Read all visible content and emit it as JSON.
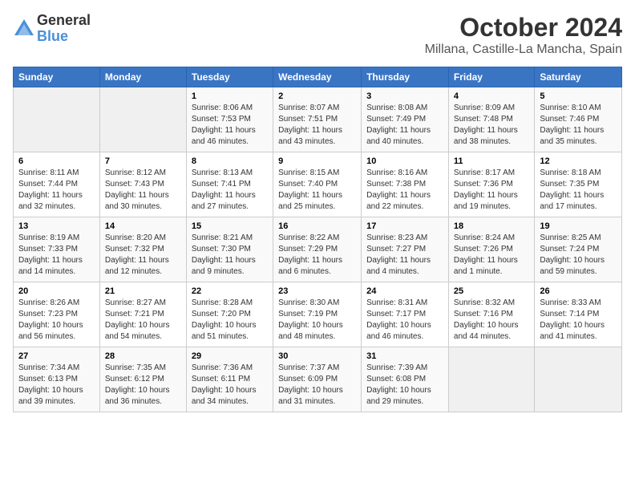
{
  "logo": {
    "general": "General",
    "blue": "Blue"
  },
  "header": {
    "month": "October 2024",
    "location": "Millana, Castille-La Mancha, Spain"
  },
  "weekdays": [
    "Sunday",
    "Monday",
    "Tuesday",
    "Wednesday",
    "Thursday",
    "Friday",
    "Saturday"
  ],
  "weeks": [
    [
      {
        "day": "",
        "empty": true
      },
      {
        "day": "",
        "empty": true
      },
      {
        "day": "1",
        "sunrise": "Sunrise: 8:06 AM",
        "sunset": "Sunset: 7:53 PM",
        "daylight": "Daylight: 11 hours and 46 minutes."
      },
      {
        "day": "2",
        "sunrise": "Sunrise: 8:07 AM",
        "sunset": "Sunset: 7:51 PM",
        "daylight": "Daylight: 11 hours and 43 minutes."
      },
      {
        "day": "3",
        "sunrise": "Sunrise: 8:08 AM",
        "sunset": "Sunset: 7:49 PM",
        "daylight": "Daylight: 11 hours and 40 minutes."
      },
      {
        "day": "4",
        "sunrise": "Sunrise: 8:09 AM",
        "sunset": "Sunset: 7:48 PM",
        "daylight": "Daylight: 11 hours and 38 minutes."
      },
      {
        "day": "5",
        "sunrise": "Sunrise: 8:10 AM",
        "sunset": "Sunset: 7:46 PM",
        "daylight": "Daylight: 11 hours and 35 minutes."
      }
    ],
    [
      {
        "day": "6",
        "sunrise": "Sunrise: 8:11 AM",
        "sunset": "Sunset: 7:44 PM",
        "daylight": "Daylight: 11 hours and 32 minutes."
      },
      {
        "day": "7",
        "sunrise": "Sunrise: 8:12 AM",
        "sunset": "Sunset: 7:43 PM",
        "daylight": "Daylight: 11 hours and 30 minutes."
      },
      {
        "day": "8",
        "sunrise": "Sunrise: 8:13 AM",
        "sunset": "Sunset: 7:41 PM",
        "daylight": "Daylight: 11 hours and 27 minutes."
      },
      {
        "day": "9",
        "sunrise": "Sunrise: 8:15 AM",
        "sunset": "Sunset: 7:40 PM",
        "daylight": "Daylight: 11 hours and 25 minutes."
      },
      {
        "day": "10",
        "sunrise": "Sunrise: 8:16 AM",
        "sunset": "Sunset: 7:38 PM",
        "daylight": "Daylight: 11 hours and 22 minutes."
      },
      {
        "day": "11",
        "sunrise": "Sunrise: 8:17 AM",
        "sunset": "Sunset: 7:36 PM",
        "daylight": "Daylight: 11 hours and 19 minutes."
      },
      {
        "day": "12",
        "sunrise": "Sunrise: 8:18 AM",
        "sunset": "Sunset: 7:35 PM",
        "daylight": "Daylight: 11 hours and 17 minutes."
      }
    ],
    [
      {
        "day": "13",
        "sunrise": "Sunrise: 8:19 AM",
        "sunset": "Sunset: 7:33 PM",
        "daylight": "Daylight: 11 hours and 14 minutes."
      },
      {
        "day": "14",
        "sunrise": "Sunrise: 8:20 AM",
        "sunset": "Sunset: 7:32 PM",
        "daylight": "Daylight: 11 hours and 12 minutes."
      },
      {
        "day": "15",
        "sunrise": "Sunrise: 8:21 AM",
        "sunset": "Sunset: 7:30 PM",
        "daylight": "Daylight: 11 hours and 9 minutes."
      },
      {
        "day": "16",
        "sunrise": "Sunrise: 8:22 AM",
        "sunset": "Sunset: 7:29 PM",
        "daylight": "Daylight: 11 hours and 6 minutes."
      },
      {
        "day": "17",
        "sunrise": "Sunrise: 8:23 AM",
        "sunset": "Sunset: 7:27 PM",
        "daylight": "Daylight: 11 hours and 4 minutes."
      },
      {
        "day": "18",
        "sunrise": "Sunrise: 8:24 AM",
        "sunset": "Sunset: 7:26 PM",
        "daylight": "Daylight: 11 hours and 1 minute."
      },
      {
        "day": "19",
        "sunrise": "Sunrise: 8:25 AM",
        "sunset": "Sunset: 7:24 PM",
        "daylight": "Daylight: 10 hours and 59 minutes."
      }
    ],
    [
      {
        "day": "20",
        "sunrise": "Sunrise: 8:26 AM",
        "sunset": "Sunset: 7:23 PM",
        "daylight": "Daylight: 10 hours and 56 minutes."
      },
      {
        "day": "21",
        "sunrise": "Sunrise: 8:27 AM",
        "sunset": "Sunset: 7:21 PM",
        "daylight": "Daylight: 10 hours and 54 minutes."
      },
      {
        "day": "22",
        "sunrise": "Sunrise: 8:28 AM",
        "sunset": "Sunset: 7:20 PM",
        "daylight": "Daylight: 10 hours and 51 minutes."
      },
      {
        "day": "23",
        "sunrise": "Sunrise: 8:30 AM",
        "sunset": "Sunset: 7:19 PM",
        "daylight": "Daylight: 10 hours and 48 minutes."
      },
      {
        "day": "24",
        "sunrise": "Sunrise: 8:31 AM",
        "sunset": "Sunset: 7:17 PM",
        "daylight": "Daylight: 10 hours and 46 minutes."
      },
      {
        "day": "25",
        "sunrise": "Sunrise: 8:32 AM",
        "sunset": "Sunset: 7:16 PM",
        "daylight": "Daylight: 10 hours and 44 minutes."
      },
      {
        "day": "26",
        "sunrise": "Sunrise: 8:33 AM",
        "sunset": "Sunset: 7:14 PM",
        "daylight": "Daylight: 10 hours and 41 minutes."
      }
    ],
    [
      {
        "day": "27",
        "sunrise": "Sunrise: 7:34 AM",
        "sunset": "Sunset: 6:13 PM",
        "daylight": "Daylight: 10 hours and 39 minutes."
      },
      {
        "day": "28",
        "sunrise": "Sunrise: 7:35 AM",
        "sunset": "Sunset: 6:12 PM",
        "daylight": "Daylight: 10 hours and 36 minutes."
      },
      {
        "day": "29",
        "sunrise": "Sunrise: 7:36 AM",
        "sunset": "Sunset: 6:11 PM",
        "daylight": "Daylight: 10 hours and 34 minutes."
      },
      {
        "day": "30",
        "sunrise": "Sunrise: 7:37 AM",
        "sunset": "Sunset: 6:09 PM",
        "daylight": "Daylight: 10 hours and 31 minutes."
      },
      {
        "day": "31",
        "sunrise": "Sunrise: 7:39 AM",
        "sunset": "Sunset: 6:08 PM",
        "daylight": "Daylight: 10 hours and 29 minutes."
      },
      {
        "day": "",
        "empty": true
      },
      {
        "day": "",
        "empty": true
      }
    ]
  ]
}
